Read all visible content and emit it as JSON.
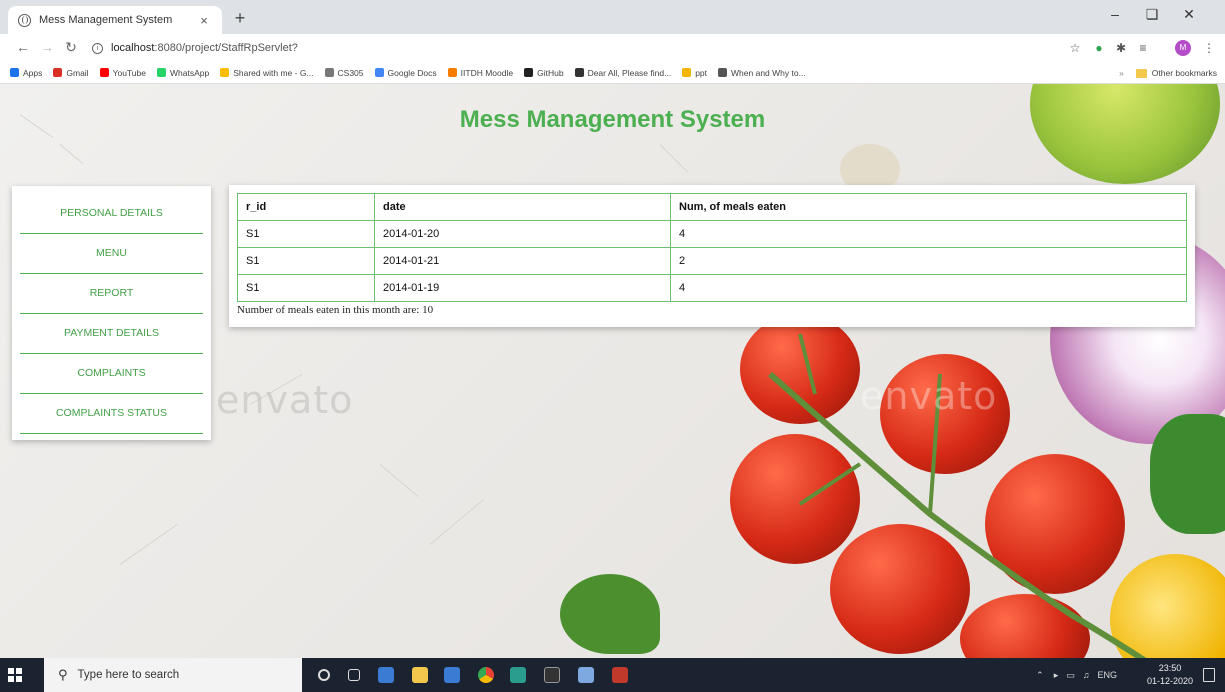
{
  "browser": {
    "tab_title": "Mess Management System",
    "tab_close": "×",
    "new_tab": "+",
    "url_host": "localhost",
    "url_rest": ":8080/project/StaffRpServlet?",
    "bookmarks": [
      {
        "label": "Apps",
        "color": "#1a73e8"
      },
      {
        "label": "Gmail",
        "color": "#d93025"
      },
      {
        "label": "YouTube",
        "color": "#ff0000"
      },
      {
        "label": "WhatsApp",
        "color": "#25d366"
      },
      {
        "label": "Shared with me - G...",
        "color": "#fbbc04"
      },
      {
        "label": "CS305",
        "color": "#777777"
      },
      {
        "label": "Google Docs",
        "color": "#4285f4"
      },
      {
        "label": "IITDH Moodle",
        "color": "#f57c00"
      },
      {
        "label": "GitHub",
        "color": "#222222"
      },
      {
        "label": "Dear All, Please find...",
        "color": "#333333"
      },
      {
        "label": "ppt",
        "color": "#f4b400"
      },
      {
        "label": "When and Why to...",
        "color": "#555555"
      }
    ],
    "other_bookmarks": "Other bookmarks",
    "chevron": "»",
    "avatar_letter": "M"
  },
  "page": {
    "title": "Mess Management System",
    "watermark": "envato",
    "sidebar": [
      "PERSONAL DETAILS",
      "MENU",
      "REPORT",
      "PAYMENT DETAILS",
      "COMPLAINTS",
      "COMPLAINTS STATUS"
    ],
    "table": {
      "headers": [
        "r_id",
        "date",
        "Num, of meals eaten"
      ],
      "rows": [
        [
          "S1",
          "2014-01-20",
          "4"
        ],
        [
          "S1",
          "2014-01-21",
          "2"
        ],
        [
          "S1",
          "2014-01-19",
          "4"
        ]
      ]
    },
    "summary": "Number of meals eaten in this month are: 10"
  },
  "taskbar": {
    "search_placeholder": "Type here to search",
    "language": "ENG",
    "time": "23:50",
    "date": "01-12-2020"
  },
  "colors": {
    "accent": "#4caf50",
    "table_border": "#6fbf73"
  }
}
